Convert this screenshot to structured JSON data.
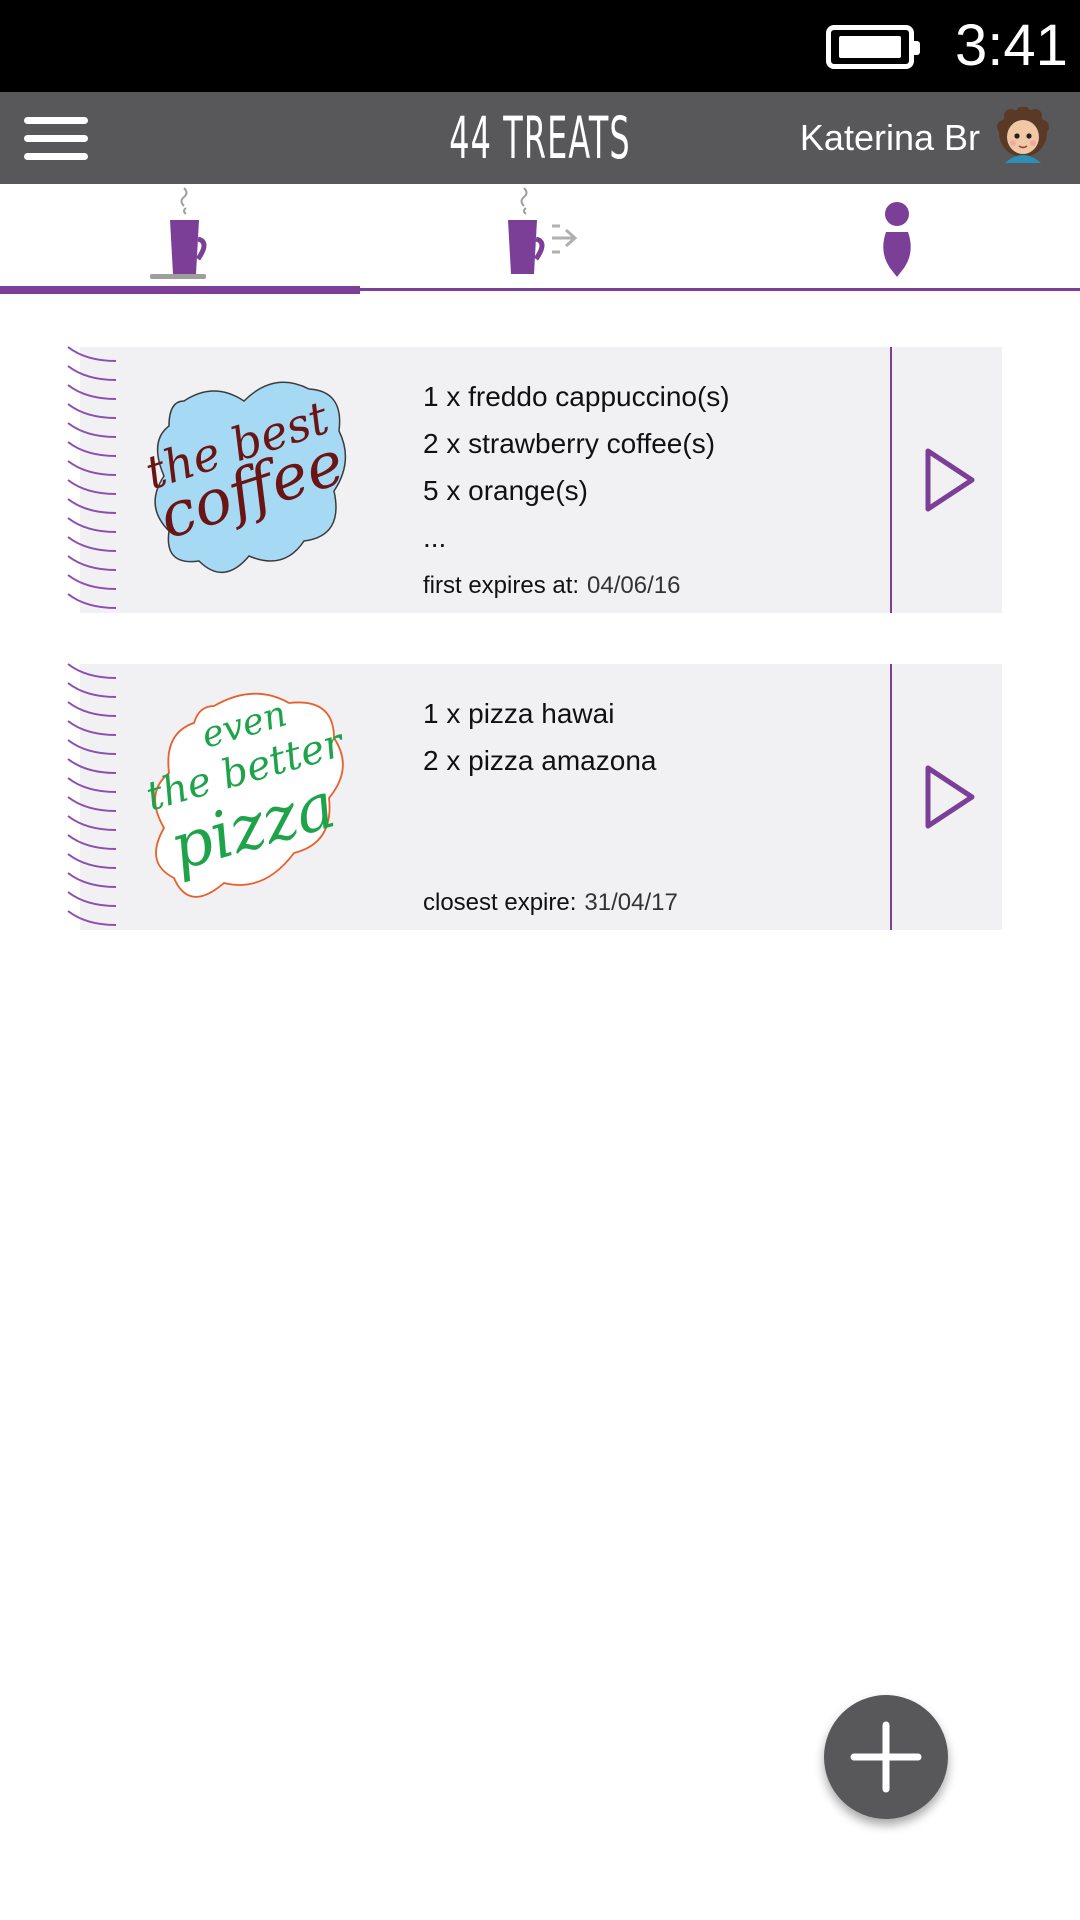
{
  "status_bar": {
    "time": "3:41",
    "battery_icon": "battery-full-icon"
  },
  "app_bar": {
    "menu_icon": "hamburger-menu-icon",
    "title": "44 TREATS",
    "user_name": "Katerina Br",
    "avatar_icon": "user-avatar"
  },
  "tabs": [
    {
      "icon": "coffee-cup-icon",
      "selected": true
    },
    {
      "icon": "coffee-send-icon",
      "selected": false
    },
    {
      "icon": "person-icon",
      "selected": false
    }
  ],
  "cards": [
    {
      "sticker_text": [
        "the best",
        "coffee"
      ],
      "items": [
        "1 x freddo cappuccino(s)",
        "2 x strawberry coffee(s)",
        "5 x orange(s)",
        "..."
      ],
      "expiry_label": "first expires at:",
      "expiry_date": "04/06/16",
      "play_icon": "play-arrow-icon"
    },
    {
      "sticker_text": [
        "even",
        "the better",
        "pizza"
      ],
      "items": [
        "1 x pizza hawai",
        "2 x pizza amazona"
      ],
      "expiry_label": "closest expire:",
      "expiry_date": "31/04/17",
      "play_icon": "play-arrow-icon"
    }
  ],
  "fab": {
    "icon": "plus-icon"
  },
  "colors": {
    "accent": "#7c3f98",
    "app_bar": "#58585a",
    "card_bg": "#f1f1f3",
    "coffee_sticker_bg": "#a6d9f4",
    "coffee_text": "#6b1414",
    "pizza_text": "#1fa34a",
    "pizza_outline": "#e8602c"
  }
}
